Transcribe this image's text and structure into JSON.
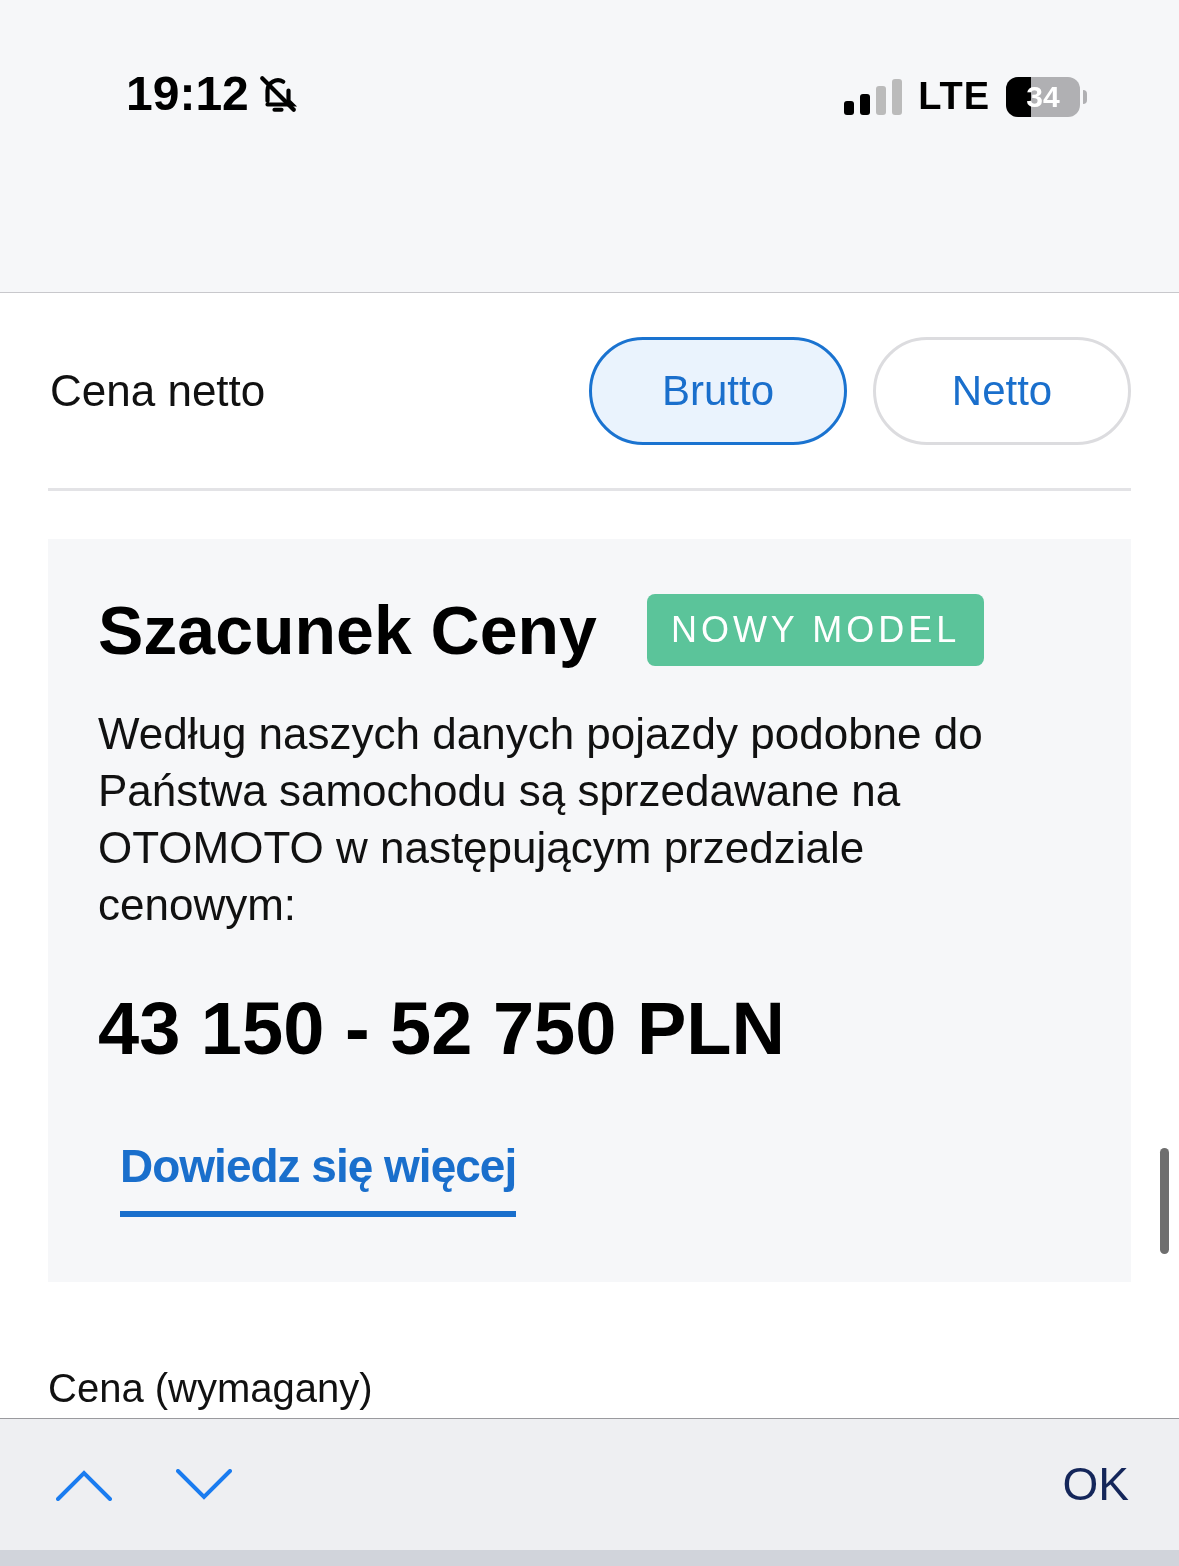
{
  "status_bar": {
    "time": "19:12",
    "network": "LTE",
    "battery": {
      "label": "34",
      "level": 0.34
    }
  },
  "price_type": {
    "label": "Cena netto",
    "options": [
      {
        "label": "Brutto",
        "selected": true
      },
      {
        "label": "Netto",
        "selected": false
      }
    ]
  },
  "estimate": {
    "title": "Szacunek Ceny",
    "badge": "NOWY MODEL",
    "description": "Według naszych danych pojazdy podobne do Państwa samochodu są sprzedawane na OTOMOTO w następującym przedziale cenowym:",
    "range": "43 150 - 52 750 PLN",
    "link": "Dowiedz się więcej"
  },
  "price_field": {
    "label": "Cena (wymagany)"
  },
  "keyboard_toolbar": {
    "done": "OK"
  }
}
